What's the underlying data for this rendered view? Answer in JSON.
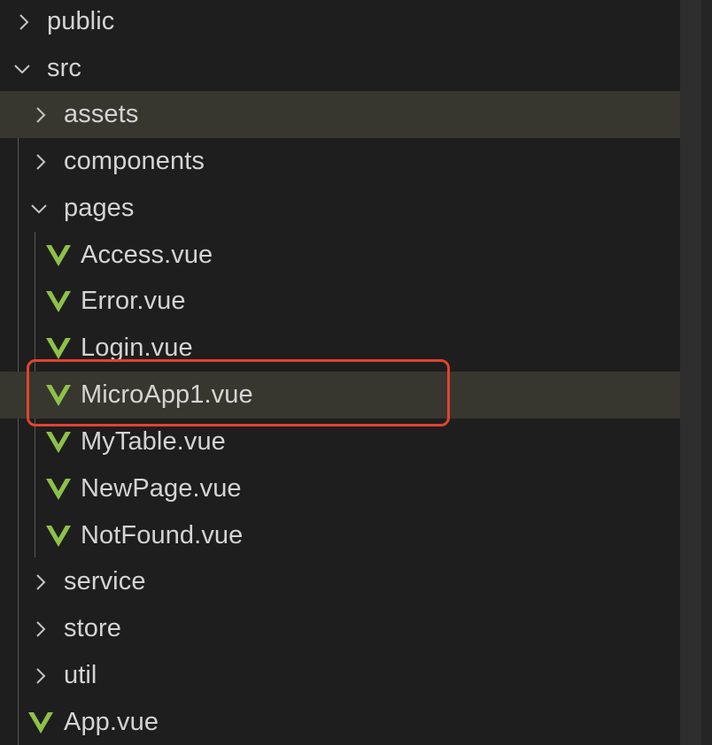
{
  "explorer": {
    "items": [
      {
        "label": "public",
        "kind": "folder",
        "expanded": false,
        "icon": "chevron-right-icon"
      },
      {
        "label": "src",
        "kind": "folder",
        "expanded": true,
        "icon": "chevron-down-icon"
      },
      {
        "label": "assets",
        "kind": "folder",
        "expanded": false,
        "icon": "chevron-right-icon"
      },
      {
        "label": "components",
        "kind": "folder",
        "expanded": false,
        "icon": "chevron-right-icon"
      },
      {
        "label": "pages",
        "kind": "folder",
        "expanded": true,
        "icon": "chevron-down-icon"
      },
      {
        "label": "Access.vue",
        "kind": "file",
        "icon": "vue-file-icon"
      },
      {
        "label": "Error.vue",
        "kind": "file",
        "icon": "vue-file-icon"
      },
      {
        "label": "Login.vue",
        "kind": "file",
        "icon": "vue-file-icon"
      },
      {
        "label": "MicroApp1.vue",
        "kind": "file",
        "icon": "vue-file-icon",
        "selected": true
      },
      {
        "label": "MyTable.vue",
        "kind": "file",
        "icon": "vue-file-icon"
      },
      {
        "label": "NewPage.vue",
        "kind": "file",
        "icon": "vue-file-icon"
      },
      {
        "label": "NotFound.vue",
        "kind": "file",
        "icon": "vue-file-icon"
      },
      {
        "label": "service",
        "kind": "folder",
        "expanded": false,
        "icon": "chevron-right-icon"
      },
      {
        "label": "store",
        "kind": "folder",
        "expanded": false,
        "icon": "chevron-right-icon"
      },
      {
        "label": "util",
        "kind": "folder",
        "expanded": false,
        "icon": "chevron-right-icon"
      },
      {
        "label": "App.vue",
        "kind": "file",
        "icon": "vue-file-icon"
      }
    ]
  },
  "colors": {
    "background": "#1e1e1e",
    "row_highlight": "#37372f",
    "text": "#d4d4d4",
    "vue_green": "#8dc149",
    "annotation_red": "#e0442f"
  }
}
